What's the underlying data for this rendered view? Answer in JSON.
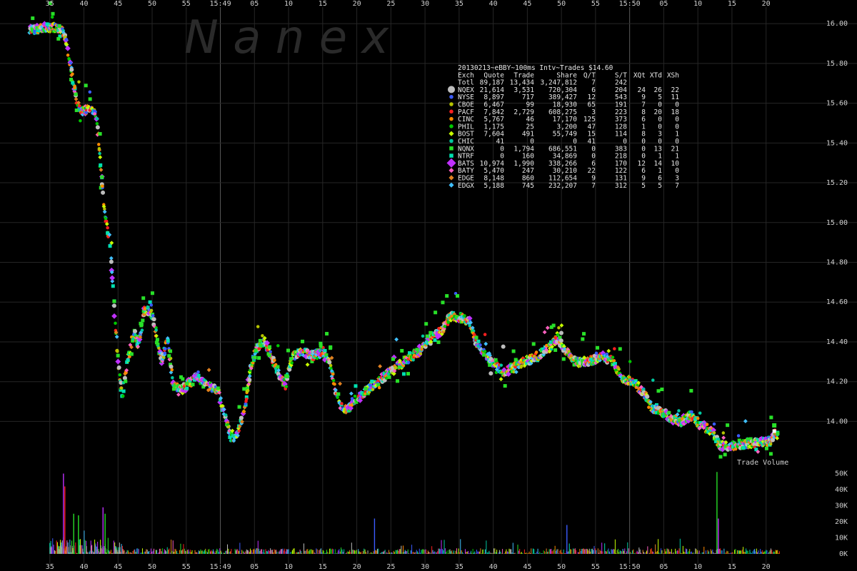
{
  "watermark": "N a n e x",
  "colors": {
    "background": "#000000",
    "grid": "#262626",
    "marker_line": "#5a5a5a",
    "text": "#d8d8d8",
    "NQEX": "#bdbdbd",
    "NYSE": "#3b5bff",
    "CBOE": "#b6c400",
    "PACF": "#ff2020",
    "CINC": "#ff8a00",
    "PHIL": "#00c800",
    "BOST": "#c8ff00",
    "CHIC": "#00c8a0",
    "NQNX": "#28e028",
    "NTRF": "#ffffff",
    "BATS": "#c030ff",
    "BATY": "#ff60c0",
    "EDGE": "#e08020",
    "EDGX": "#40c0ff"
  },
  "table": {
    "title": "20130213~eBBY~100ms Intv~Trades $14.60",
    "headers": [
      "Exch",
      "Quote",
      "Trade",
      "Share",
      "Q/T",
      "S/T",
      "XQt",
      "XTd",
      "XSh"
    ],
    "rows": [
      {
        "exch": "Totl",
        "quote": "89,187",
        "trade": "13,434",
        "share": "3,247,812",
        "qt": "7",
        "st": "242",
        "xqt": "",
        "xtd": "",
        "xsh": "",
        "marker": "none",
        "color": "#ffffff"
      },
      {
        "exch": "NQEX",
        "quote": "21,614",
        "trade": "3,531",
        "share": "720,304",
        "qt": "6",
        "st": "204",
        "xqt": "24",
        "xtd": "26",
        "xsh": "22",
        "marker": "circle-large",
        "color": "#bdbdbd"
      },
      {
        "exch": "NYSE",
        "quote": "8,897",
        "trade": "717",
        "share": "389,427",
        "qt": "12",
        "st": "543",
        "xqt": "9",
        "xtd": "5",
        "xsh": "11",
        "marker": "circle",
        "color": "#3b5bff"
      },
      {
        "exch": "CBOE",
        "quote": "6,467",
        "trade": "99",
        "share": "18,930",
        "qt": "65",
        "st": "191",
        "xqt": "7",
        "xtd": "0",
        "xsh": "0",
        "marker": "circle",
        "color": "#b6c400"
      },
      {
        "exch": "PACF",
        "quote": "7,842",
        "trade": "2,729",
        "share": "608,275",
        "qt": "3",
        "st": "223",
        "xqt": "8",
        "xtd": "20",
        "xsh": "18",
        "marker": "circle",
        "color": "#ff2020"
      },
      {
        "exch": "CINC",
        "quote": "5,767",
        "trade": "46",
        "share": "17,170",
        "qt": "125",
        "st": "373",
        "xqt": "6",
        "xtd": "0",
        "xsh": "0",
        "marker": "circle",
        "color": "#ff8a00"
      },
      {
        "exch": "PHIL",
        "quote": "1,175",
        "trade": "25",
        "share": "3,200",
        "qt": "47",
        "st": "128",
        "xqt": "1",
        "xtd": "0",
        "xsh": "0",
        "marker": "circle",
        "color": "#00c800"
      },
      {
        "exch": "BOST",
        "quote": "7,604",
        "trade": "491",
        "share": "55,749",
        "qt": "15",
        "st": "114",
        "xqt": "8",
        "xtd": "3",
        "xsh": "1",
        "marker": "diamond",
        "color": "#c8ff00"
      },
      {
        "exch": "CHIC",
        "quote": "41",
        "trade": "0",
        "share": "0",
        "qt": "41",
        "st": "0",
        "xqt": "0",
        "xtd": "0",
        "xsh": "0",
        "marker": "circle",
        "color": "#00c8a0"
      },
      {
        "exch": "NQNX",
        "quote": "0",
        "trade": "1,794",
        "share": "686,551",
        "qt": "0",
        "st": "383",
        "xqt": "0",
        "xtd": "13",
        "xsh": "21",
        "marker": "square",
        "color": "#28e028"
      },
      {
        "exch": "NTRF",
        "quote": "0",
        "trade": "160",
        "share": "34,869",
        "qt": "0",
        "st": "218",
        "xqt": "0",
        "xtd": "1",
        "xsh": "1",
        "marker": "square",
        "color": "#00e0b0"
      },
      {
        "exch": "BATS",
        "quote": "10,974",
        "trade": "1,990",
        "share": "338,266",
        "qt": "6",
        "st": "170",
        "xqt": "12",
        "xtd": "14",
        "xsh": "10",
        "marker": "diamond-large",
        "color": "#c030ff"
      },
      {
        "exch": "BATY",
        "quote": "5,470",
        "trade": "247",
        "share": "30,210",
        "qt": "22",
        "st": "122",
        "xqt": "6",
        "xtd": "1",
        "xsh": "0",
        "marker": "diamond",
        "color": "#ff60c0"
      },
      {
        "exch": "EDGE",
        "quote": "8,148",
        "trade": "860",
        "share": "112,654",
        "qt": "9",
        "st": "131",
        "xqt": "9",
        "xtd": "6",
        "xsh": "3",
        "marker": "diamond",
        "color": "#e08020"
      },
      {
        "exch": "EDGX",
        "quote": "5,188",
        "trade": "745",
        "share": "232,207",
        "qt": "7",
        "st": "312",
        "xqt": "5",
        "xtd": "5",
        "xsh": "7",
        "marker": "diamond",
        "color": "#40c0ff"
      }
    ]
  },
  "chart_data": [
    {
      "type": "scatter",
      "title": "",
      "xlabel": "",
      "ylabel": "",
      "x_unit": "seconds after 15:48:30",
      "xlim": [
        0,
        116
      ],
      "ylim": [
        13.84,
        16.04
      ],
      "x_ticks": [
        {
          "x": 5,
          "label": "35"
        },
        {
          "x": 10,
          "label": "40"
        },
        {
          "x": 15,
          "label": "45"
        },
        {
          "x": 20,
          "label": "50"
        },
        {
          "x": 25,
          "label": "55"
        },
        {
          "x": 30,
          "label": "15:49"
        },
        {
          "x": 35,
          "label": "05"
        },
        {
          "x": 40,
          "label": "10"
        },
        {
          "x": 45,
          "label": "15"
        },
        {
          "x": 50,
          "label": "20"
        },
        {
          "x": 55,
          "label": "25"
        },
        {
          "x": 60,
          "label": "30"
        },
        {
          "x": 65,
          "label": "35"
        },
        {
          "x": 70,
          "label": "40"
        },
        {
          "x": 75,
          "label": "45"
        },
        {
          "x": 80,
          "label": "50"
        },
        {
          "x": 85,
          "label": "55"
        },
        {
          "x": 90,
          "label": "15:50"
        },
        {
          "x": 95,
          "label": "05"
        },
        {
          "x": 100,
          "label": "10"
        },
        {
          "x": 105,
          "label": "15"
        },
        {
          "x": 110,
          "label": "20"
        }
      ],
      "minute_markers": [
        30,
        90
      ],
      "y_ticks": [
        14.0,
        14.2,
        14.4,
        14.6,
        14.8,
        15.0,
        15.2,
        15.4,
        15.6,
        15.8,
        16.0
      ],
      "grid": true,
      "price_path": [
        [
          2,
          15.97
        ],
        [
          4.5,
          15.98
        ],
        [
          6,
          15.98
        ],
        [
          6.8,
          15.96
        ],
        [
          7.5,
          15.9
        ],
        [
          8.2,
          15.75
        ],
        [
          9,
          15.6
        ],
        [
          9.8,
          15.56
        ],
        [
          10.8,
          15.58
        ],
        [
          11.8,
          15.54
        ],
        [
          12.4,
          15.3
        ],
        [
          13,
          15.05
        ],
        [
          13.8,
          14.9
        ],
        [
          14.4,
          14.6
        ],
        [
          15,
          14.3
        ],
        [
          15.6,
          14.12
        ],
        [
          16.4,
          14.3
        ],
        [
          17.3,
          14.45
        ],
        [
          18,
          14.38
        ],
        [
          18.8,
          14.55
        ],
        [
          19.5,
          14.56
        ],
        [
          20.2,
          14.52
        ],
        [
          21,
          14.35
        ],
        [
          21.5,
          14.3
        ],
        [
          22.3,
          14.43
        ],
        [
          23,
          14.2
        ],
        [
          24,
          14.15
        ],
        [
          25,
          14.18
        ],
        [
          26.5,
          14.22
        ],
        [
          28,
          14.18
        ],
        [
          29.5,
          14.16
        ],
        [
          30.5,
          14.05
        ],
        [
          31.5,
          13.92
        ],
        [
          32.5,
          13.93
        ],
        [
          33.5,
          14.05
        ],
        [
          34.5,
          14.28
        ],
        [
          35.5,
          14.38
        ],
        [
          36.5,
          14.4
        ],
        [
          37.5,
          14.32
        ],
        [
          38.5,
          14.25
        ],
        [
          39.5,
          14.18
        ],
        [
          40.5,
          14.32
        ],
        [
          42,
          14.35
        ],
        [
          43.5,
          14.33
        ],
        [
          45,
          14.35
        ],
        [
          46,
          14.3
        ],
        [
          47,
          14.15
        ],
        [
          48,
          14.05
        ],
        [
          49,
          14.08
        ],
        [
          50,
          14.12
        ],
        [
          51.5,
          14.16
        ],
        [
          53,
          14.2
        ],
        [
          55,
          14.25
        ],
        [
          57,
          14.3
        ],
        [
          59,
          14.35
        ],
        [
          61,
          14.42
        ],
        [
          62.5,
          14.46
        ],
        [
          63.5,
          14.52
        ],
        [
          65,
          14.53
        ],
        [
          66.5,
          14.5
        ],
        [
          67.5,
          14.4
        ],
        [
          68.5,
          14.35
        ],
        [
          70,
          14.3
        ],
        [
          71.5,
          14.25
        ],
        [
          73,
          14.27
        ],
        [
          74.5,
          14.3
        ],
        [
          76,
          14.32
        ],
        [
          77.5,
          14.35
        ],
        [
          78.5,
          14.38
        ],
        [
          79.5,
          14.42
        ],
        [
          80.5,
          14.36
        ],
        [
          82,
          14.3
        ],
        [
          84,
          14.3
        ],
        [
          86,
          14.33
        ],
        [
          87.5,
          14.3
        ],
        [
          89,
          14.22
        ],
        [
          90.5,
          14.2
        ],
        [
          92,
          14.15
        ],
        [
          93,
          14.08
        ],
        [
          94.5,
          14.05
        ],
        [
          96,
          14.02
        ],
        [
          97.5,
          14.0
        ],
        [
          99,
          14.03
        ],
        [
          100.5,
          13.98
        ],
        [
          102,
          13.95
        ],
        [
          103.3,
          13.88
        ],
        [
          105,
          13.88
        ],
        [
          107,
          13.89
        ],
        [
          109,
          13.89
        ],
        [
          110.5,
          13.9
        ],
        [
          111.2,
          13.94
        ],
        [
          111.8,
          13.92
        ]
      ],
      "spike": {
        "x": 111.2,
        "y": 13.98
      }
    },
    {
      "type": "bar",
      "title": "Trade Volume",
      "ylim": [
        0,
        52000
      ],
      "y_ticks": [
        {
          "value": 0,
          "label": "0K"
        },
        {
          "value": 10000,
          "label": "10K"
        },
        {
          "value": 20000,
          "label": "20K"
        },
        {
          "value": 30000,
          "label": "30K"
        },
        {
          "value": 40000,
          "label": "40K"
        },
        {
          "value": 50000,
          "label": "50K"
        }
      ],
      "notable_bars": [
        {
          "x": 7.0,
          "value": 50000,
          "color": "#c030ff"
        },
        {
          "x": 7.2,
          "value": 42000,
          "color": "#ff2020"
        },
        {
          "x": 8.5,
          "value": 25000,
          "color": "#28e028"
        },
        {
          "x": 9.2,
          "value": 24000,
          "color": "#28e028"
        },
        {
          "x": 12.8,
          "value": 29000,
          "color": "#c030ff"
        },
        {
          "x": 13.1,
          "value": 25000,
          "color": "#28e028"
        },
        {
          "x": 52.6,
          "value": 22000,
          "color": "#3b5bff"
        },
        {
          "x": 80.8,
          "value": 18000,
          "color": "#3b5bff"
        },
        {
          "x": 102.8,
          "value": 51000,
          "color": "#28e028"
        },
        {
          "x": 103.0,
          "value": 22000,
          "color": "#c030ff"
        }
      ]
    }
  ]
}
